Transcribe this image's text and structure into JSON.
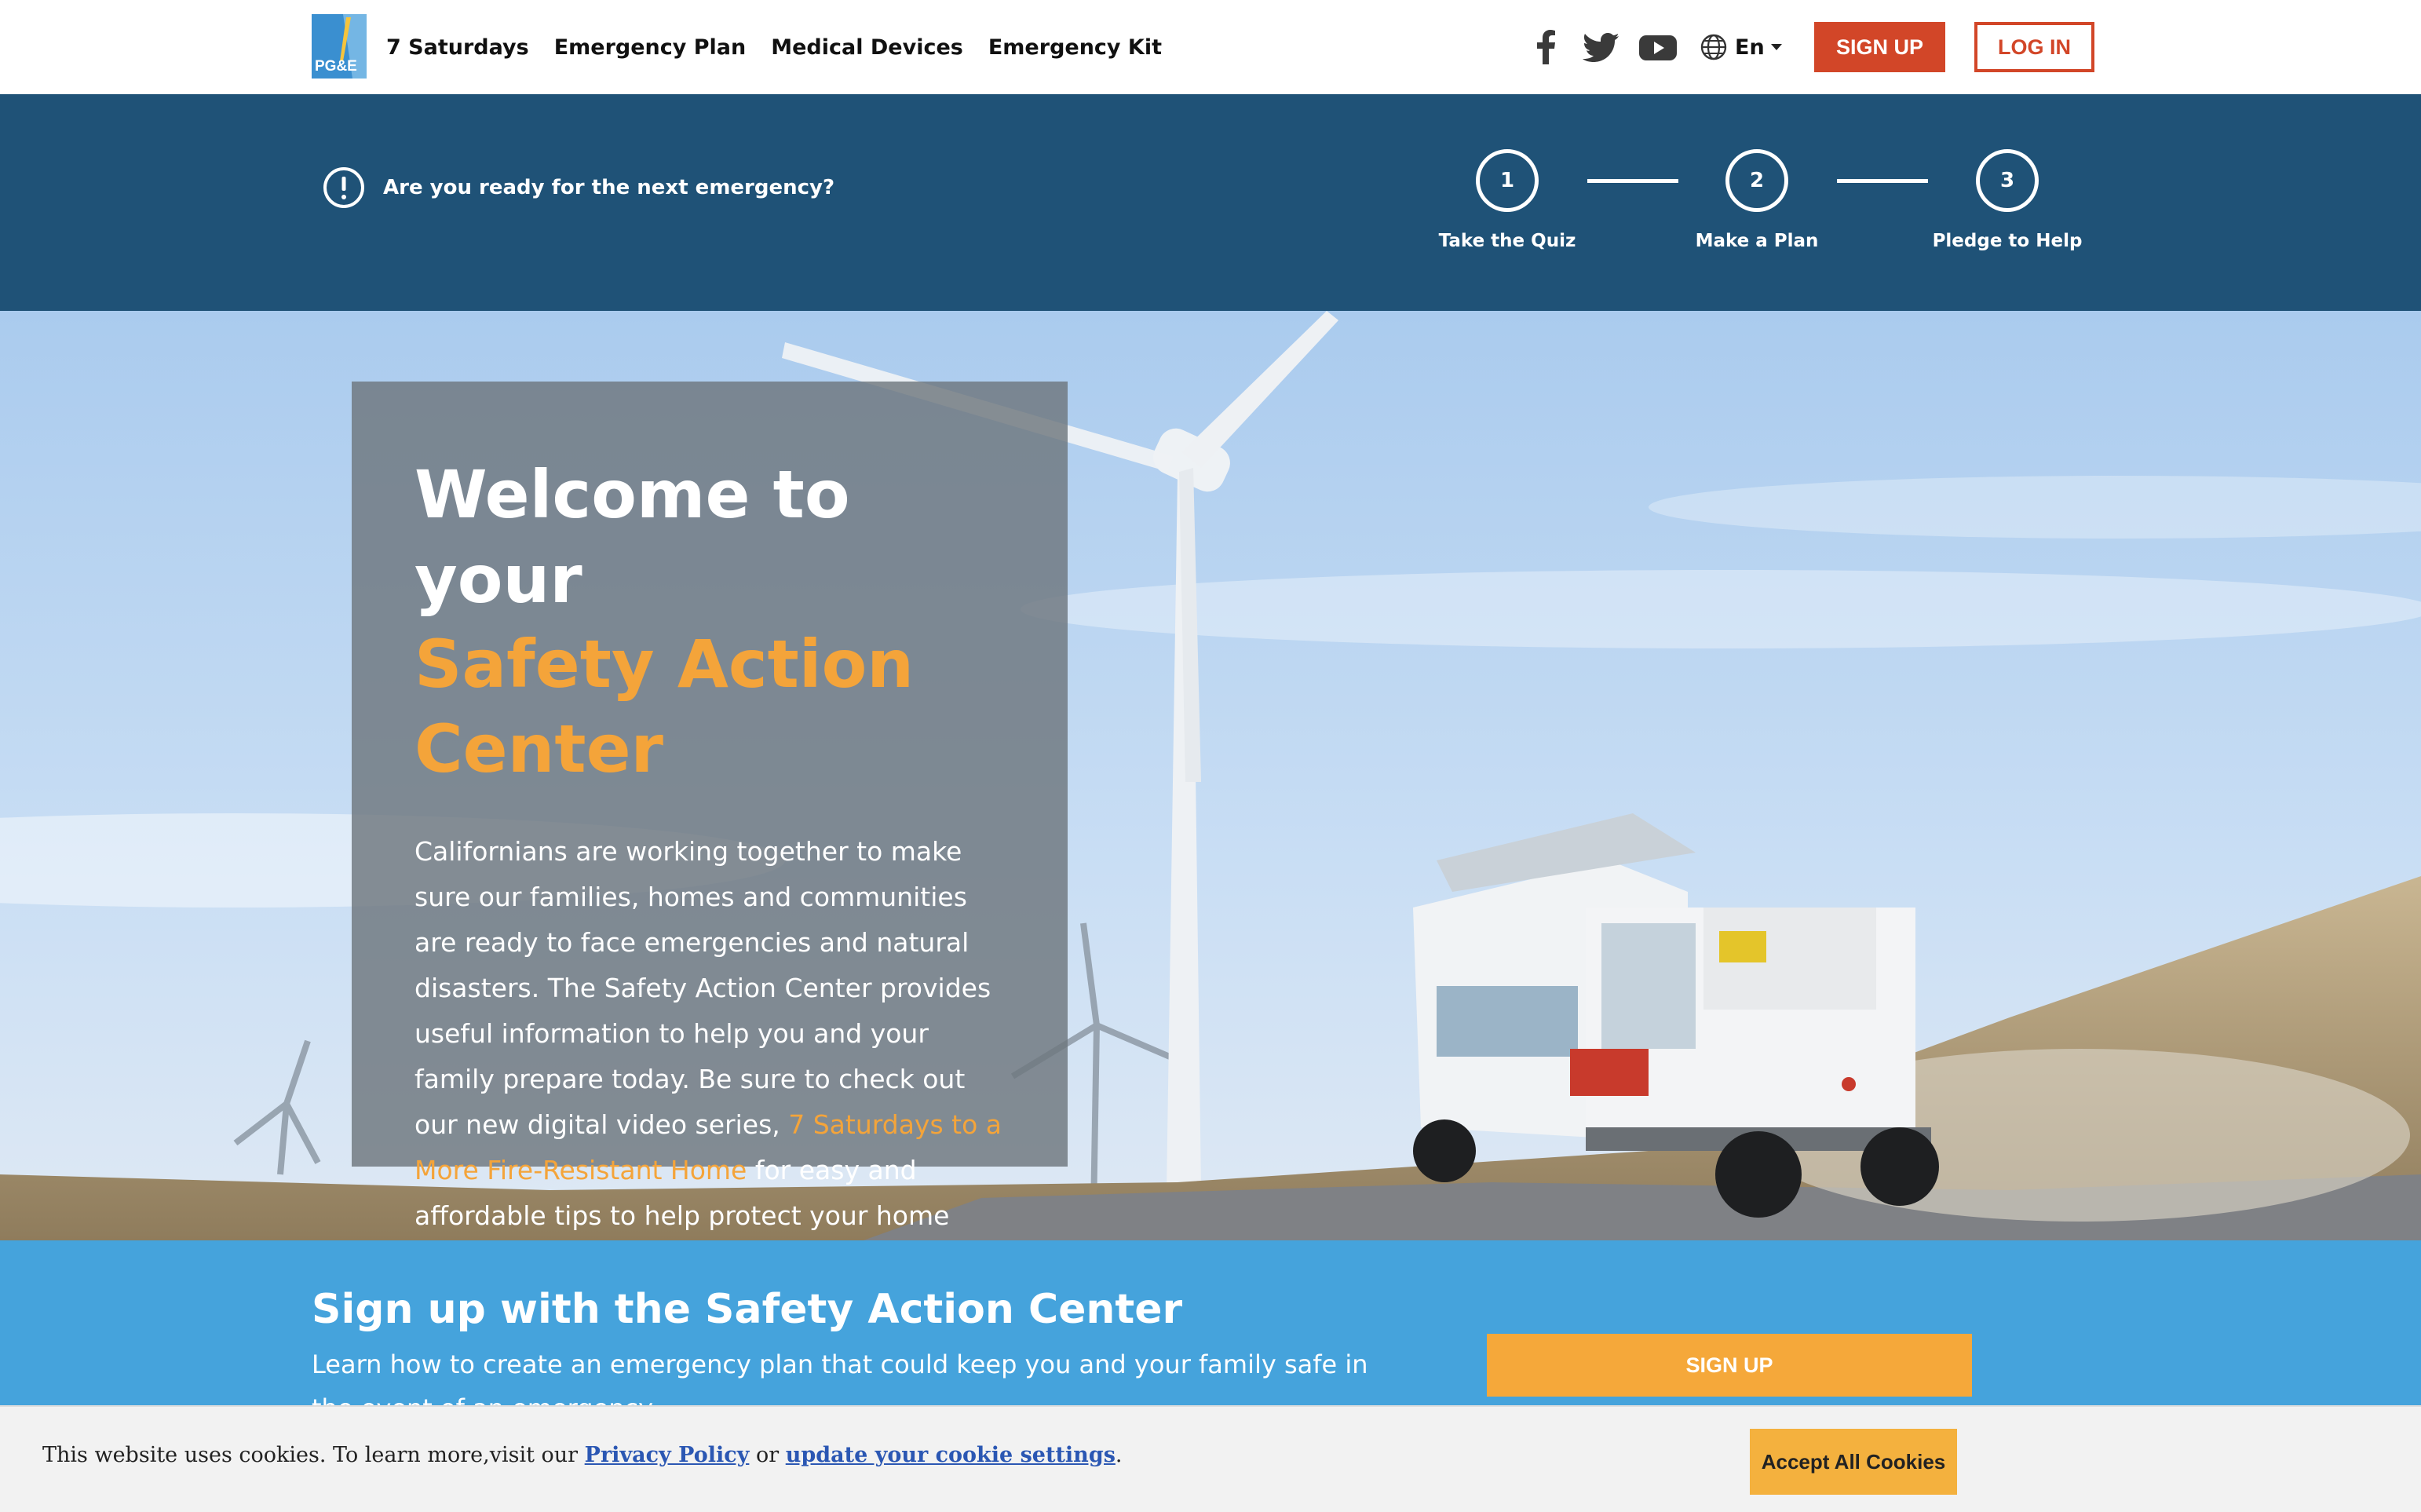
{
  "nav": {
    "brand": "PG&E",
    "links": [
      "7 Saturdays",
      "Emergency Plan",
      "Medical Devices",
      "Emergency Kit"
    ],
    "social_icons": [
      "facebook-icon",
      "twitter-icon",
      "youtube-icon"
    ],
    "language": "En",
    "signup_label": "SIGN UP",
    "login_label": "LOG IN"
  },
  "steps": {
    "question": "Are you ready for the next emergency?",
    "items": [
      {
        "number": "1",
        "label": "Take the Quiz"
      },
      {
        "number": "2",
        "label": "Make a Plan"
      },
      {
        "number": "3",
        "label": "Pledge to Help"
      }
    ]
  },
  "hero": {
    "title_line1": "Welcome to your",
    "title_line2": "Safety Action Center",
    "body_before_link": "Californians are working together to make sure our families, homes and communities are ready to face emergencies and natural disasters. The Safety Action Center provides useful information to help you and your family prepare today. Be sure to check out our new digital video series, ",
    "body_link": "7 Saturdays to a More Fire-Resistant Home",
    "body_after_link": " for easy and affordable tips to help protect your home during wildfire season."
  },
  "signup_band": {
    "heading": "Sign up with the Safety Action Center",
    "text": "Learn how to create an emergency plan that could keep you and your family safe in the event of an emergency.",
    "button_label": "SIGN UP"
  },
  "cookie": {
    "text_before": "This website uses cookies. To learn more,visit our ",
    "privacy_link": "Privacy Policy",
    "text_middle": " or ",
    "settings_link": "update your cookie settings",
    "text_after": ".",
    "accept_label": "Accept All Cookies"
  },
  "colors": {
    "brand_red": "#d24628",
    "steps_navy": "#1f5277",
    "accent_orange": "#f4a43a",
    "signup_blue": "#45a3dc",
    "cookie_button": "#f4b13e"
  }
}
